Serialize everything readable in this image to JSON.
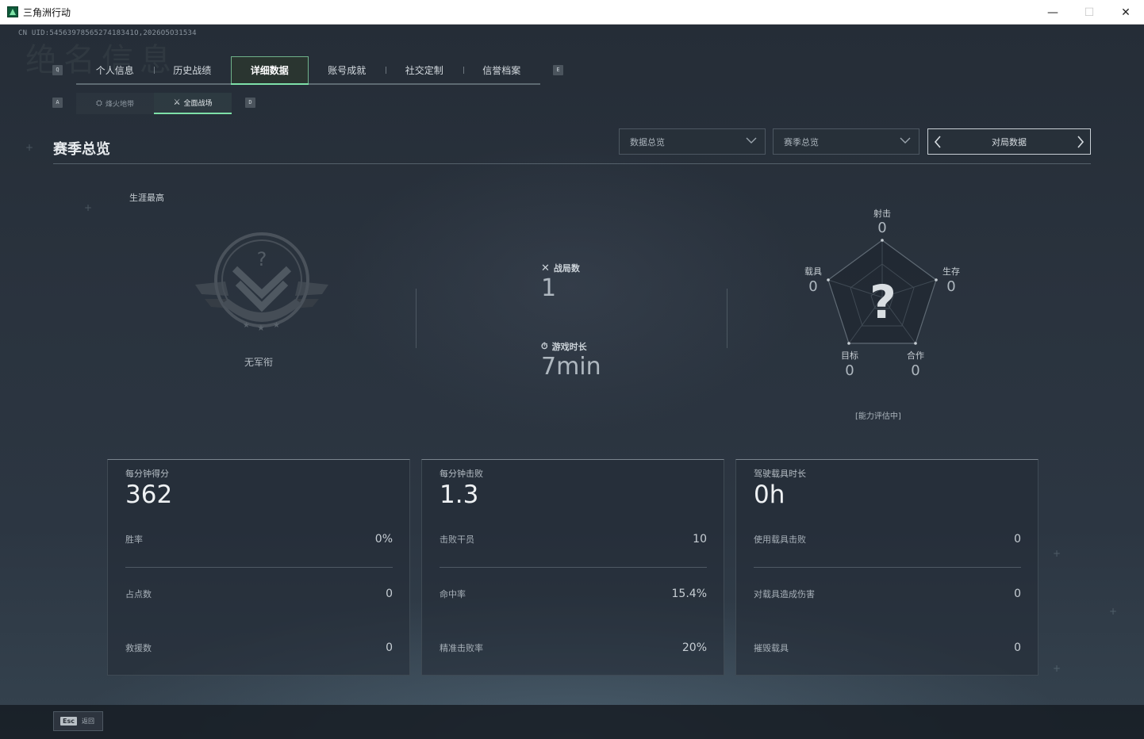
{
  "window": {
    "title": "三角洲行动",
    "minimize": "—",
    "maximize": "☐",
    "close": "✕"
  },
  "uid": "CN UID:5456397856527418341O,2026O5O31534",
  "ghost_title": "绝名信息",
  "tabs": {
    "left_key": "Q",
    "right_key": "E",
    "items": [
      {
        "label": "个人信息"
      },
      {
        "label": "历史战绩"
      },
      {
        "label": "详细数据",
        "active": true
      },
      {
        "label": "账号成就"
      },
      {
        "label": "社交定制"
      },
      {
        "label": "信誉档案"
      }
    ]
  },
  "subtabs": {
    "left_key": "A",
    "right_key": "D",
    "items": [
      {
        "label": "烽火地带",
        "icon": "fire-zone-icon"
      },
      {
        "label": "全面战场",
        "icon": "battlefield-icon",
        "active": true
      }
    ]
  },
  "section": {
    "title": "赛季总览",
    "dropdown1": "数据总览",
    "dropdown2": "赛季总览",
    "pager": "对局数据"
  },
  "rank": {
    "label": "生涯最高",
    "name": "无军衔"
  },
  "center": {
    "matches_label": "战局数",
    "matches_value": "1",
    "playtime_label": "游戏时长",
    "playtime_value": "7min"
  },
  "radar": {
    "center_glyph": "?",
    "caption": "[能力评估中]",
    "axes": [
      {
        "label": "射击",
        "value": "0"
      },
      {
        "label": "生存",
        "value": "0"
      },
      {
        "label": "合作",
        "value": "0"
      },
      {
        "label": "目标",
        "value": "0"
      },
      {
        "label": "载具",
        "value": "0"
      }
    ]
  },
  "cards": [
    {
      "head": "每分钟得分",
      "big": "362",
      "rows": [
        {
          "k": "胜率",
          "v": "0%"
        },
        {
          "k": "占点数",
          "v": "0"
        },
        {
          "k": "救援数",
          "v": "0"
        }
      ]
    },
    {
      "head": "每分钟击败",
      "big": "1.3",
      "rows": [
        {
          "k": "击败干员",
          "v": "10"
        },
        {
          "k": "命中率",
          "v": "15.4%"
        },
        {
          "k": "精准击败率",
          "v": "20%"
        }
      ]
    },
    {
      "head": "驾驶载具时长",
      "big": "0h",
      "rows": [
        {
          "k": "使用载具击败",
          "v": "0"
        },
        {
          "k": "对载具造成伤害",
          "v": "0"
        },
        {
          "k": "摧毁载具",
          "v": "0"
        }
      ]
    }
  ],
  "footer": {
    "key": "Esc",
    "label": "返回"
  },
  "colors": {
    "accent": "#7ee0a8",
    "background": "#252d37"
  }
}
